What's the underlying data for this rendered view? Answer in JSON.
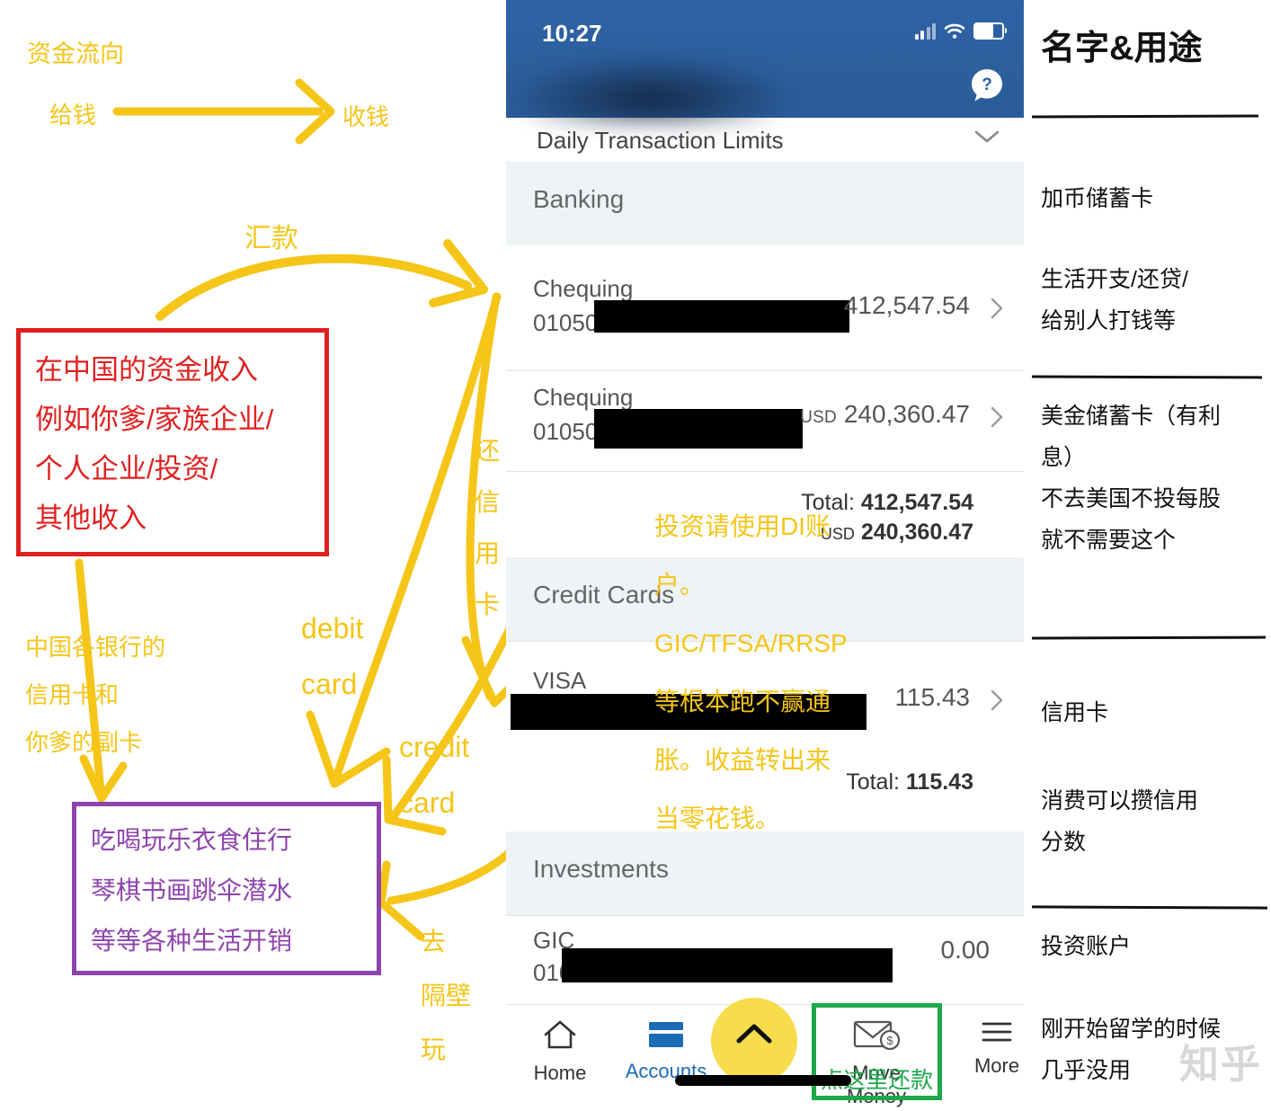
{
  "legend": {
    "title": "资金流向",
    "give": "给钱",
    "receive": "收钱"
  },
  "annotations": {
    "income_box": "在中国的资金收入\n例如你爹/家族企业/\n个人企业/投资/\n其他收入",
    "spend_box": "吃喝玩乐衣食住行\n琴棋书画跳伞潜水\n等等各种生活开销",
    "china_cards": "中国各银行的\n信用卡和\n你爹的副卡",
    "remittance": "汇款",
    "repay_credit": "还信用卡",
    "debit_card": "debit\ncard",
    "credit_card": "credit\ncard",
    "go_next_door": "去\n隔壁\n玩",
    "investment_note": "投资请使用DI账户。GIC/TFSA/RRSP等根本跑不赢通胀。收益转出来当零花钱。"
  },
  "phone": {
    "status_bar": {
      "time": "10:27",
      "signal_icon": "signal-bars-icon",
      "wifi_icon": "wifi-icon",
      "battery_icon": "battery-icon"
    },
    "help_icon": "help-question-icon",
    "daily_limits": {
      "label": "Daily Transaction Limits",
      "chevron_icon": "chevron-down-icon"
    },
    "sections": [
      {
        "header": "Banking",
        "rows": [
          {
            "name": "Chequing",
            "number": "01050-",
            "currency": "",
            "amount": "412,547.54"
          },
          {
            "name": "Chequing",
            "number": "01050-",
            "currency": "USD",
            "amount": "240,360.47"
          }
        ],
        "totals": [
          {
            "label": "Total:",
            "currency": "",
            "amount": "412,547.54"
          },
          {
            "label": "",
            "currency": "USD",
            "amount": "240,360.47"
          }
        ]
      },
      {
        "header": "Credit Cards",
        "rows": [
          {
            "name": "VISA",
            "number": "",
            "currency": "",
            "amount": "115.43"
          }
        ],
        "totals": [
          {
            "label": "Total:",
            "currency": "",
            "amount": "115.43"
          }
        ]
      },
      {
        "header": "Investments",
        "rows": [
          {
            "name": "GIC",
            "number": "010",
            "currency": "",
            "amount": "0.00"
          }
        ],
        "totals": []
      }
    ],
    "navbar": [
      {
        "label": "Home",
        "icon": "home-icon"
      },
      {
        "label": "Accounts",
        "icon": "card-icon"
      },
      {
        "label": "Move Money",
        "icon": "envelope-dollar-icon"
      },
      {
        "label": "More",
        "icon": "hamburger-menu-icon"
      }
    ],
    "fab_icon": "chevron-up-icon",
    "move_money_callout": "点这里还款"
  },
  "right_column": {
    "title": "名字&用途",
    "items": [
      "加币储蓄卡",
      "生活开支/还贷/\n给别人打钱等",
      "美金储蓄卡（有利\n息）\n不去美国不投每股\n就不需要这个",
      "信用卡",
      "消费可以攒信用\n分数",
      "投资账户",
      "刚开始留学的时候\n几乎没用"
    ]
  },
  "watermark": "知乎",
  "colors": {
    "yellow": "#F5C518",
    "red": "#E02020",
    "purple": "#8E44AD",
    "green": "#1DA84C",
    "bank_blue": "#2d5f9e"
  }
}
